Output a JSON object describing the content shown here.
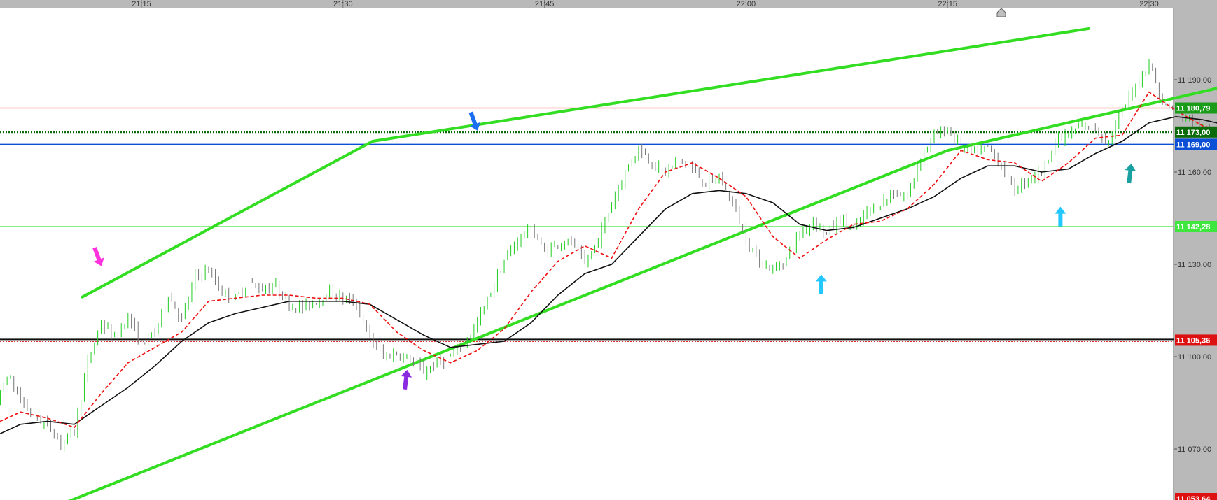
{
  "chart_data": {
    "type": "candlestick",
    "x_ticks": [
      "21:15",
      "21:30",
      "21:45",
      "22:00",
      "22:15",
      "22:30"
    ],
    "y_ticks": [
      "11 190,00",
      "11 160,00",
      "11 130,00",
      "11 100,00",
      "11 070,00"
    ],
    "ylim": [
      11049,
      11208
    ],
    "xlim_minutes": [
      1262,
      1350.5
    ],
    "price_series": [
      [
        1262,
        11083
      ],
      [
        1263,
        11079
      ],
      [
        1264,
        11082
      ],
      [
        1265,
        11094
      ],
      [
        1266,
        11086
      ],
      [
        1267,
        11080
      ],
      [
        1268,
        11078
      ],
      [
        1269,
        11072
      ],
      [
        1270,
        11076
      ],
      [
        1271,
        11098
      ],
      [
        1272,
        11111
      ],
      [
        1273,
        11106
      ],
      [
        1274,
        11113
      ],
      [
        1275,
        11104
      ],
      [
        1276,
        11108
      ],
      [
        1277,
        11120
      ],
      [
        1278,
        11112
      ],
      [
        1279,
        11126
      ],
      [
        1280,
        11128
      ],
      [
        1281,
        11121
      ],
      [
        1282,
        11119
      ],
      [
        1283,
        11124
      ],
      [
        1284,
        11122
      ],
      [
        1285,
        11123
      ],
      [
        1286,
        11117
      ],
      [
        1287,
        11116
      ],
      [
        1288,
        11118
      ],
      [
        1289,
        11121
      ],
      [
        1290,
        11119
      ],
      [
        1291,
        11117
      ],
      [
        1292,
        11106
      ],
      [
        1293,
        11100
      ],
      [
        1294,
        11101
      ],
      [
        1295,
        11099
      ],
      [
        1296,
        11095
      ],
      [
        1297,
        11098
      ],
      [
        1298,
        11100
      ],
      [
        1299,
        11104
      ],
      [
        1300,
        11111
      ],
      [
        1301,
        11121
      ],
      [
        1302,
        11131
      ],
      [
        1303,
        11138
      ],
      [
        1304,
        11142
      ],
      [
        1305,
        11134
      ],
      [
        1306,
        11137
      ],
      [
        1307,
        11137
      ],
      [
        1308,
        11130
      ],
      [
        1309,
        11138
      ],
      [
        1310,
        11150
      ],
      [
        1311,
        11160
      ],
      [
        1312,
        11168
      ],
      [
        1313,
        11163
      ],
      [
        1314,
        11160
      ],
      [
        1315,
        11164
      ],
      [
        1316,
        11161
      ],
      [
        1317,
        11156
      ],
      [
        1318,
        11158
      ],
      [
        1319,
        11150
      ],
      [
        1320,
        11138
      ],
      [
        1321,
        11131
      ],
      [
        1322,
        11128
      ],
      [
        1323,
        11132
      ],
      [
        1324,
        11140
      ],
      [
        1325,
        11144
      ],
      [
        1326,
        11140
      ],
      [
        1327,
        11145
      ],
      [
        1328,
        11141
      ],
      [
        1329,
        11147
      ],
      [
        1330,
        11150
      ],
      [
        1331,
        11153
      ],
      [
        1332,
        11152
      ],
      [
        1333,
        11165
      ],
      [
        1334,
        11172
      ],
      [
        1335,
        11174
      ],
      [
        1336,
        11168
      ],
      [
        1337,
        11166
      ],
      [
        1338,
        11168
      ],
      [
        1339,
        11162
      ],
      [
        1340,
        11154
      ],
      [
        1341,
        11158
      ],
      [
        1342,
        11160
      ],
      [
        1343,
        11170
      ],
      [
        1344,
        11172
      ],
      [
        1345,
        11175
      ],
      [
        1346,
        11174
      ],
      [
        1347,
        11170
      ],
      [
        1348,
        11180
      ],
      [
        1349,
        11188
      ],
      [
        1350,
        11196
      ],
      [
        1351,
        11182
      ],
      [
        1352,
        11180
      ],
      [
        1353,
        11177
      ],
      [
        1354,
        11173
      ],
      [
        1355,
        11174
      ],
      [
        1356,
        11171
      ],
      [
        1357,
        11167
      ],
      [
        1358,
        11166
      ],
      [
        1359,
        11172
      ],
      [
        1360,
        11175
      ],
      [
        1361,
        11172
      ],
      [
        1362,
        11171
      ],
      [
        1363,
        11169
      ],
      [
        1364,
        11173
      ],
      [
        1365,
        11176
      ],
      [
        1366,
        11179
      ],
      [
        1367,
        11178
      ],
      [
        1368,
        11178
      ],
      [
        1369,
        11175
      ],
      [
        1370,
        11177
      ],
      [
        1371,
        11172
      ],
      [
        1372,
        11172
      ],
      [
        1373,
        11175
      ],
      [
        1374,
        11174
      ],
      [
        1375,
        11173
      ],
      [
        1376,
        11174
      ],
      [
        1377,
        11177
      ],
      [
        1378,
        11180
      ]
    ],
    "ema_fast": [
      [
        1262,
        11077
      ],
      [
        1264,
        11078
      ],
      [
        1266,
        11082
      ],
      [
        1268,
        11080
      ],
      [
        1270,
        11077
      ],
      [
        1272,
        11088
      ],
      [
        1274,
        11098
      ],
      [
        1276,
        11103
      ],
      [
        1278,
        11108
      ],
      [
        1280,
        11118
      ],
      [
        1282,
        11119
      ],
      [
        1284,
        11120
      ],
      [
        1286,
        11120
      ],
      [
        1288,
        11119
      ],
      [
        1290,
        11119
      ],
      [
        1292,
        11117
      ],
      [
        1294,
        11108
      ],
      [
        1296,
        11102
      ],
      [
        1298,
        11098
      ],
      [
        1300,
        11102
      ],
      [
        1302,
        11109
      ],
      [
        1304,
        11121
      ],
      [
        1306,
        11131
      ],
      [
        1308,
        11136
      ],
      [
        1310,
        11132
      ],
      [
        1312,
        11148
      ],
      [
        1314,
        11160
      ],
      [
        1316,
        11163
      ],
      [
        1318,
        11158
      ],
      [
        1320,
        11152
      ],
      [
        1322,
        11139
      ],
      [
        1324,
        11132
      ],
      [
        1326,
        11138
      ],
      [
        1328,
        11143
      ],
      [
        1330,
        11144
      ],
      [
        1332,
        11148
      ],
      [
        1334,
        11156
      ],
      [
        1336,
        11167
      ],
      [
        1338,
        11164
      ],
      [
        1340,
        11163
      ],
      [
        1342,
        11157
      ],
      [
        1344,
        11163
      ],
      [
        1346,
        11171
      ],
      [
        1348,
        11172
      ],
      [
        1350,
        11186
      ],
      [
        1352,
        11180
      ],
      [
        1354,
        11175
      ],
      [
        1356,
        11173
      ],
      [
        1358,
        11168
      ],
      [
        1360,
        11172
      ],
      [
        1362,
        11172
      ],
      [
        1364,
        11172
      ],
      [
        1366,
        11175
      ],
      [
        1368,
        11176
      ],
      [
        1370,
        11174
      ],
      [
        1372,
        11174
      ],
      [
        1374,
        11173
      ],
      [
        1376,
        11173
      ],
      [
        1378,
        11176
      ]
    ],
    "ema_slow": [
      [
        1262,
        11072
      ],
      [
        1264,
        11074
      ],
      [
        1266,
        11078
      ],
      [
        1268,
        11079
      ],
      [
        1270,
        11078
      ],
      [
        1272,
        11084
      ],
      [
        1274,
        11090
      ],
      [
        1276,
        11097
      ],
      [
        1278,
        11105
      ],
      [
        1280,
        11111
      ],
      [
        1282,
        11114
      ],
      [
        1284,
        11116
      ],
      [
        1286,
        11118
      ],
      [
        1288,
        11118
      ],
      [
        1290,
        11118
      ],
      [
        1292,
        11117
      ],
      [
        1294,
        11112
      ],
      [
        1296,
        11107
      ],
      [
        1298,
        11103
      ],
      [
        1300,
        11104
      ],
      [
        1302,
        11105
      ],
      [
        1304,
        11111
      ],
      [
        1306,
        11120
      ],
      [
        1308,
        11127
      ],
      [
        1310,
        11130
      ],
      [
        1312,
        11139
      ],
      [
        1314,
        11148
      ],
      [
        1316,
        11153
      ],
      [
        1318,
        11154
      ],
      [
        1320,
        11153
      ],
      [
        1322,
        11150
      ],
      [
        1324,
        11143
      ],
      [
        1326,
        11141
      ],
      [
        1328,
        11142
      ],
      [
        1330,
        11145
      ],
      [
        1332,
        11148
      ],
      [
        1334,
        11152
      ],
      [
        1336,
        11158
      ],
      [
        1338,
        11162
      ],
      [
        1340,
        11162
      ],
      [
        1342,
        11160
      ],
      [
        1344,
        11161
      ],
      [
        1346,
        11166
      ],
      [
        1348,
        11170
      ],
      [
        1350,
        11176
      ],
      [
        1352,
        11178
      ],
      [
        1354,
        11177
      ],
      [
        1356,
        11175
      ],
      [
        1358,
        11172
      ],
      [
        1360,
        11171
      ],
      [
        1362,
        11172
      ],
      [
        1364,
        11172
      ],
      [
        1366,
        11173
      ],
      [
        1368,
        11175
      ],
      [
        1370,
        11174
      ],
      [
        1372,
        11174
      ],
      [
        1374,
        11173
      ],
      [
        1376,
        11172
      ],
      [
        1378,
        11175
      ]
    ],
    "level_lines": [
      {
        "value": 11180.79,
        "label": "11 180,79",
        "color": "#ff2a2a",
        "badge": "#1a9c1a",
        "style": "solid"
      },
      {
        "value": 11173.0,
        "label": "11 173,00",
        "color": "#0b6b0b",
        "badge": "#0b6b0b",
        "style": "dotted"
      },
      {
        "value": 11169.0,
        "label": "11 169,00",
        "color": "#0a4fd6",
        "badge": "#0a4fd6",
        "style": "solid"
      },
      {
        "value": 11142.28,
        "label": "11 142,28",
        "color": "#3ee63e",
        "badge": "#3ee63e",
        "style": "solid"
      },
      {
        "value": 11105.36,
        "label": "11 105,36",
        "color": "#111111",
        "badge": "#dd1111",
        "style": "black-red"
      },
      {
        "value": 11053.64,
        "label": "11 053,64",
        "color": "#dd1111",
        "badge": "#dd1111",
        "style": "offscreen"
      }
    ],
    "trend_lines": [
      {
        "from": [
          1270.6,
          11119.4
        ],
        "to": [
          1292.2,
          11170.0
        ],
        "color": "#33dd22"
      },
      {
        "from": [
          1292.2,
          11170.0
        ],
        "to": [
          1345.5,
          11206.6
        ],
        "color": "#33dd22"
      },
      {
        "from": [
          1268.1,
          11050.4
        ],
        "to": [
          1335.0,
          11167.0
        ],
        "color": "#33dd22"
      },
      {
        "from": [
          1335.0,
          11167.0
        ],
        "to": [
          1360.8,
          11193.0
        ],
        "color": "#33dd22"
      }
    ],
    "arrows": [
      {
        "name": "magenta-down",
        "at": [
          1271.8,
          11132.0
        ],
        "dir": "down",
        "color": "#ff33dd"
      },
      {
        "name": "purple-up",
        "at": [
          1294.7,
          11093.0
        ],
        "dir": "up",
        "color": "#8a2be2"
      },
      {
        "name": "blue-down",
        "at": [
          1299.8,
          11176.0
        ],
        "dir": "down",
        "color": "#1a6ef0"
      },
      {
        "name": "cyan-up-1",
        "at": [
          1325.6,
          11124.0
        ],
        "dir": "up",
        "color": "#22c8ff"
      },
      {
        "name": "cyan-up-2",
        "at": [
          1343.4,
          11146.0
        ],
        "dir": "up",
        "color": "#22c8ff"
      },
      {
        "name": "teal-up",
        "at": [
          1348.6,
          11160.0
        ],
        "dir": "up",
        "color": "#1aa0a0"
      }
    ]
  }
}
